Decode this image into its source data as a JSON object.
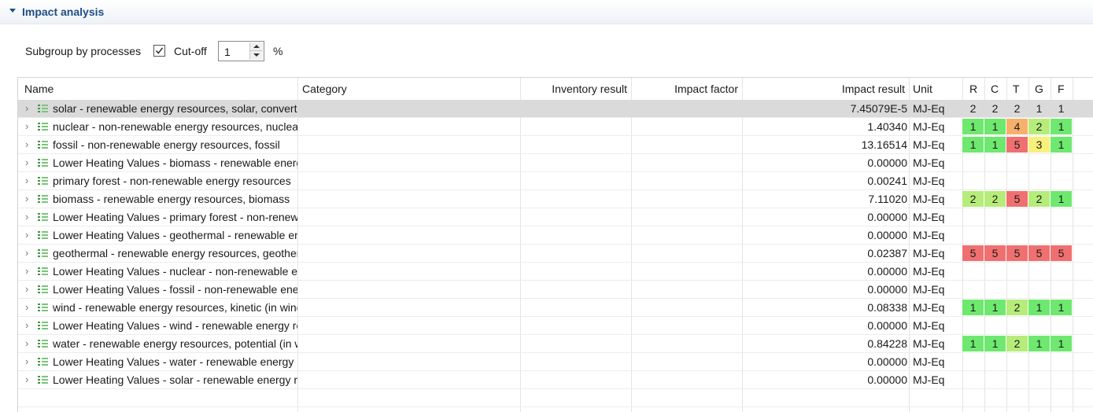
{
  "section": {
    "title": "Impact analysis"
  },
  "options": {
    "subgroup_label": "Subgroup by processes",
    "subgroup_checked": true,
    "cutoff_label": "Cut-off",
    "cutoff_value": "1",
    "percent_label": "%"
  },
  "table": {
    "headers": {
      "name": "Name",
      "category": "Category",
      "inventory": "Inventory result",
      "factor": "Impact factor",
      "impact": "Impact result",
      "unit": "Unit",
      "r": "R",
      "c": "C",
      "t": "T",
      "g": "G",
      "f": "F"
    },
    "score_colors": {
      "1": "#6ee86e",
      "2": "#b6ec7a",
      "3": "#f8f07a",
      "4": "#f6b06a",
      "5": "#f07070"
    },
    "rows": [
      {
        "name": "solar - renewable energy resources, solar, converted",
        "impact": "7.45079E-5",
        "unit": "MJ-Eq",
        "selected": true,
        "scores": [
          "2",
          "2",
          "2",
          "1",
          "1"
        ],
        "colored": false
      },
      {
        "name": "nuclear - non-renewable energy resources, nuclear",
        "impact": "1.40340",
        "unit": "MJ-Eq",
        "scores": [
          "1",
          "1",
          "4",
          "2",
          "1"
        ],
        "colored": true
      },
      {
        "name": "fossil - non-renewable energy resources, fossil",
        "impact": "13.16514",
        "unit": "MJ-Eq",
        "scores": [
          "1",
          "1",
          "5",
          "3",
          "1"
        ],
        "colored": true
      },
      {
        "name": "Lower Heating Values - biomass - renewable energy resources",
        "impact": "0.00000",
        "unit": "MJ-Eq",
        "scores": []
      },
      {
        "name": "primary forest - non-renewable energy resources",
        "impact": "0.00241",
        "unit": "MJ-Eq",
        "scores": []
      },
      {
        "name": "biomass - renewable energy resources, biomass",
        "impact": "7.11020",
        "unit": "MJ-Eq",
        "scores": [
          "2",
          "2",
          "5",
          "2",
          "1"
        ],
        "colored": true
      },
      {
        "name": "Lower Heating Values - primary forest - non-renewable",
        "impact": "0.00000",
        "unit": "MJ-Eq",
        "scores": []
      },
      {
        "name": "Lower Heating Values - geothermal - renewable energy",
        "impact": "0.00000",
        "unit": "MJ-Eq",
        "scores": []
      },
      {
        "name": "geothermal - renewable energy resources, geothermal",
        "impact": "0.02387",
        "unit": "MJ-Eq",
        "scores": [
          "5",
          "5",
          "5",
          "5",
          "5"
        ],
        "colored": true
      },
      {
        "name": "Lower Heating Values - nuclear - non-renewable energy",
        "impact": "0.00000",
        "unit": "MJ-Eq",
        "scores": []
      },
      {
        "name": "Lower Heating Values - fossil - non-renewable energy",
        "impact": "0.00000",
        "unit": "MJ-Eq",
        "scores": []
      },
      {
        "name": "wind - renewable energy resources, kinetic (in wind)",
        "impact": "0.08338",
        "unit": "MJ-Eq",
        "scores": [
          "1",
          "1",
          "2",
          "1",
          "1"
        ],
        "colored": true
      },
      {
        "name": "Lower Heating Values - wind - renewable energy resources",
        "impact": "0.00000",
        "unit": "MJ-Eq",
        "scores": []
      },
      {
        "name": "water - renewable energy resources, potential (in water)",
        "impact": "0.84228",
        "unit": "MJ-Eq",
        "scores": [
          "1",
          "1",
          "2",
          "1",
          "1"
        ],
        "colored": true
      },
      {
        "name": "Lower Heating Values - water - renewable energy resources",
        "impact": "0.00000",
        "unit": "MJ-Eq",
        "scores": []
      },
      {
        "name": "Lower Heating Values - solar - renewable energy resources",
        "impact": "0.00000",
        "unit": "MJ-Eq",
        "scores": []
      }
    ]
  }
}
